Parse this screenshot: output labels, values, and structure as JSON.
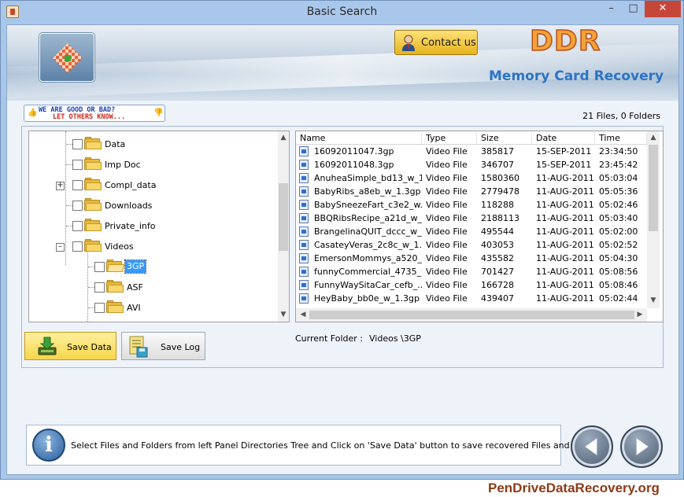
{
  "window": {
    "title": "Basic Search",
    "controls": {
      "minimize": "–",
      "maximize": "□",
      "close": "✕"
    }
  },
  "banner": {
    "contact_label": "Contact us",
    "brand": "DDR",
    "product": "Memory Card Recovery"
  },
  "feedback": {
    "line1": "WE ARE GOOD OR BAD?",
    "line2": "LET OTHERS KNOW..."
  },
  "file_count": "21 Files, 0 Folders",
  "tree": {
    "items": [
      {
        "label": "Data",
        "expander": ""
      },
      {
        "label": "Imp Doc",
        "expander": ""
      },
      {
        "label": "Compl_data",
        "expander": "+"
      },
      {
        "label": "Downloads",
        "expander": ""
      },
      {
        "label": "Private_info",
        "expander": ""
      },
      {
        "label": "Videos",
        "expander": "–"
      },
      {
        "label": "3GP",
        "expander": "",
        "selected": true
      },
      {
        "label": "ASF",
        "expander": ""
      },
      {
        "label": "AVI",
        "expander": ""
      }
    ]
  },
  "table": {
    "columns": [
      "Name",
      "Type",
      "Size",
      "Date",
      "Time"
    ],
    "rows": [
      [
        "16092011047.3gp",
        "Video File",
        "385817",
        "15-SEP-2011",
        "23:34:50"
      ],
      [
        "16092011048.3gp",
        "Video File",
        "346707",
        "15-SEP-2011",
        "23:45:42"
      ],
      [
        "AnuheaSimple_bd13_w_1....",
        "Video File",
        "1580360",
        "11-AUG-2011",
        "05:03:04"
      ],
      [
        "BabyRibs_a8eb_w_1.3gp",
        "Video File",
        "2779478",
        "11-AUG-2011",
        "05:05:36"
      ],
      [
        "BabySneezeFart_c3e2_w....",
        "Video File",
        "118288",
        "11-AUG-2011",
        "05:02:46"
      ],
      [
        "BBQRibsRecipe_a21d_w_...",
        "Video File",
        "2188113",
        "11-AUG-2011",
        "05:03:40"
      ],
      [
        "BrangelinaQUIT_dccc_w_...",
        "Video File",
        "495544",
        "11-AUG-2011",
        "05:02:00"
      ],
      [
        "CasateyVeras_2c8c_w_1....",
        "Video File",
        "403053",
        "11-AUG-2011",
        "05:02:52"
      ],
      [
        "EmersonMommys_a520_w...",
        "Video File",
        "435582",
        "11-AUG-2011",
        "05:04:30"
      ],
      [
        "funnyCommercial_4735_w...",
        "Video File",
        "701427",
        "11-AUG-2011",
        "05:08:56"
      ],
      [
        "FunnyWaySitaCar_cefb_...",
        "Video File",
        "166728",
        "11-AUG-2011",
        "05:08:46"
      ],
      [
        "HeyBaby_bb0e_w_1.3gp",
        "Video File",
        "439407",
        "11-AUG-2011",
        "05:02:44"
      ]
    ]
  },
  "buttons": {
    "save_data": "Save Data",
    "save_log": "Save Log"
  },
  "current_folder": {
    "label": "Current Folder :",
    "value": "Videos \\3GP"
  },
  "status": "Select Files and Folders from left Panel Directories Tree and Click on 'Save Data' button to save recovered Files and Folders.",
  "watermark": "PenDriveDataRecovery.org",
  "colors": {
    "accent": "#2c74c4",
    "brand": "#f4a23a",
    "selection": "#3399ff",
    "watermark": "#8b3b17"
  }
}
